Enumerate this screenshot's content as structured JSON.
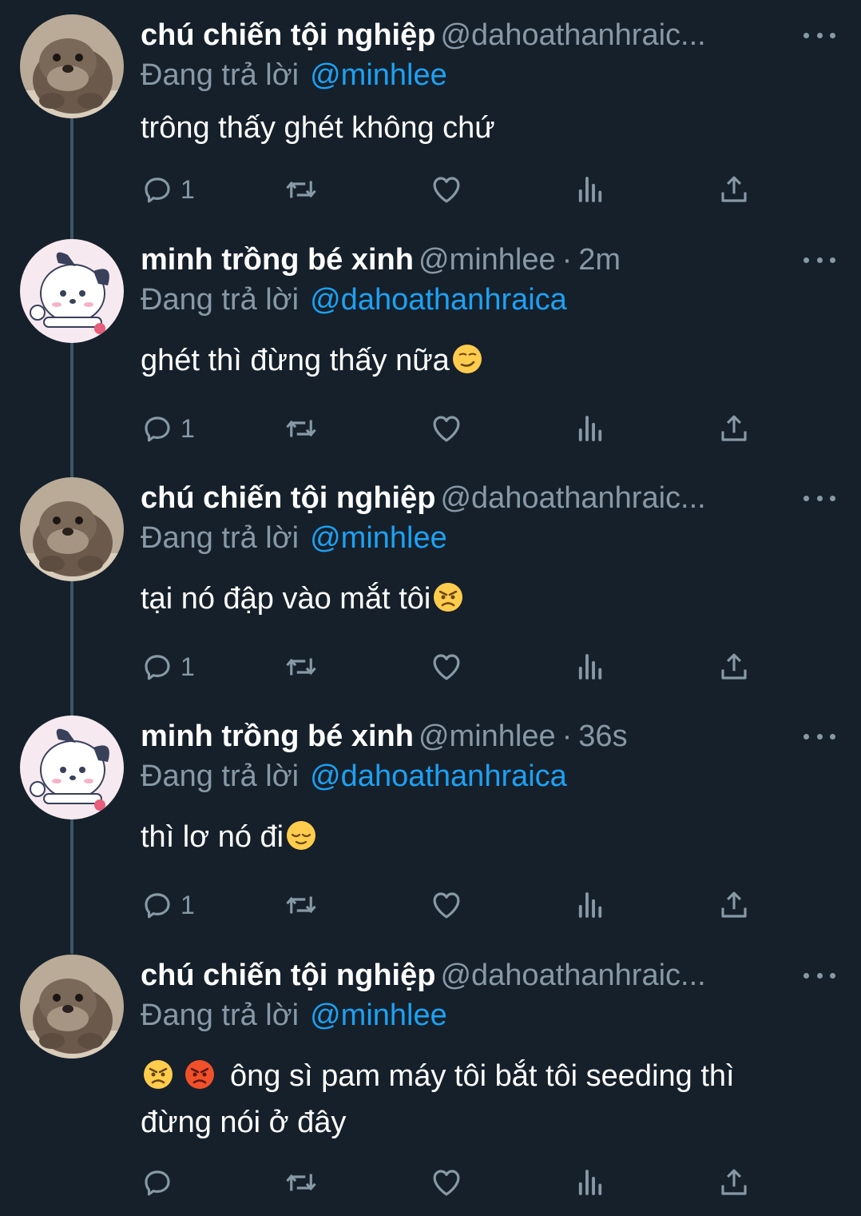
{
  "colors": {
    "background": "#15202b",
    "muted": "#8899a6",
    "link": "#1da1f2",
    "thread_line": "#3d5466"
  },
  "tweets": [
    {
      "name": "chú chiến tội nghiệp",
      "handle": "@dahoathanhraic...",
      "time": "",
      "reply_label": "Đang trả lời",
      "reply_handle": "@minhlee",
      "text": "trông thấy ghét không chứ",
      "emoji_after": "",
      "reply_count": "1",
      "avatar": "otter"
    },
    {
      "name": "minh trồng bé xinh",
      "handle": "@minhlee",
      "time": "2m",
      "reply_label": "Đang trả lời",
      "reply_handle": "@dahoathanhraica",
      "text": "ghét thì đừng thấy nữa",
      "emoji_after": "smirk",
      "reply_count": "1",
      "avatar": "pochacco"
    },
    {
      "name": "chú chiến tội nghiệp",
      "handle": "@dahoathanhraic...",
      "time": "",
      "reply_label": "Đang trả lời",
      "reply_handle": "@minhlee",
      "text": "tại nó đập vào mắt tôi",
      "emoji_after": "angry",
      "reply_count": "1",
      "avatar": "otter"
    },
    {
      "name": "minh trồng bé xinh",
      "handle": "@minhlee",
      "time": "36s",
      "reply_label": "Đang trả lời",
      "reply_handle": "@dahoathanhraica",
      "text": "thì lơ nó đi",
      "emoji_after": "relieved",
      "reply_count": "1",
      "avatar": "pochacco"
    },
    {
      "name": "chú chiến tội nghiệp",
      "handle": "@dahoathanhraic...",
      "time": "",
      "reply_label": "Đang trả lời",
      "reply_handle": "@minhlee",
      "text_line1": "ông sì pam máy tôi bắt tôi seeding thì",
      "text_line2": "đừng nói ở đây",
      "emoji_before": [
        "angry",
        "pouting"
      ],
      "reply_count": "",
      "avatar": "otter"
    }
  ],
  "icons": [
    "reply-icon",
    "retweet-icon",
    "like-icon",
    "analytics-icon",
    "share-icon",
    "more-icon"
  ]
}
